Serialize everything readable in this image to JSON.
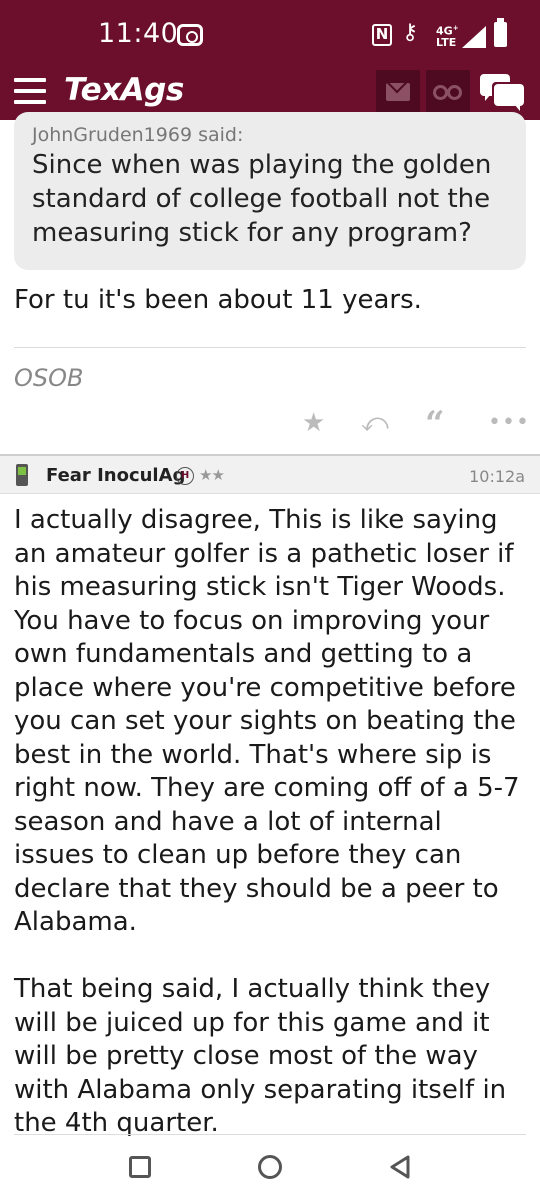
{
  "status_bar": {
    "time": "11:40",
    "network": "4G+ LTE",
    "nfc": "N",
    "key": "⚷"
  },
  "app_header": {
    "logo": "TexAgs",
    "brand_color": "#6b0f2c",
    "icons": [
      "menu-icon",
      "mail-icon",
      "binoculars-icon",
      "chat-icon"
    ]
  },
  "quote": {
    "attribution": "JohnGruden1969 said:",
    "text": "Since when was playing the golden standard of college football not the measuring stick for any program?"
  },
  "first_post": {
    "reply": "For tu it's been about 11 years.",
    "signature": "OSOB",
    "actions": {
      "star": "★",
      "reply": "⤺",
      "quote": "“",
      "more": "•••"
    }
  },
  "second_post": {
    "author": "Fear InoculAg",
    "badge": "H",
    "stars": "★★",
    "time": "10:12a",
    "paragraphs": [
      "I actually disagree, This is like saying an amateur golfer is a pathetic loser if his measuring stick isn't Tiger Woods. You have to focus on improving your own fundamentals and getting to a place where you're competitive before you can set your sights on beating the best in the world. That's where sip is right now. They are coming off of a 5-7 season and have a lot of internal issues to clean up before they can declare that they should be a peer to Alabama.",
      "That being said, I actually think they will be juiced up for this game and it will be pretty close most of the way with Alabama only separating itself in the 4th quarter."
    ]
  },
  "nav_bar": {
    "icons": [
      "recents-icon",
      "home-icon",
      "back-icon"
    ]
  }
}
